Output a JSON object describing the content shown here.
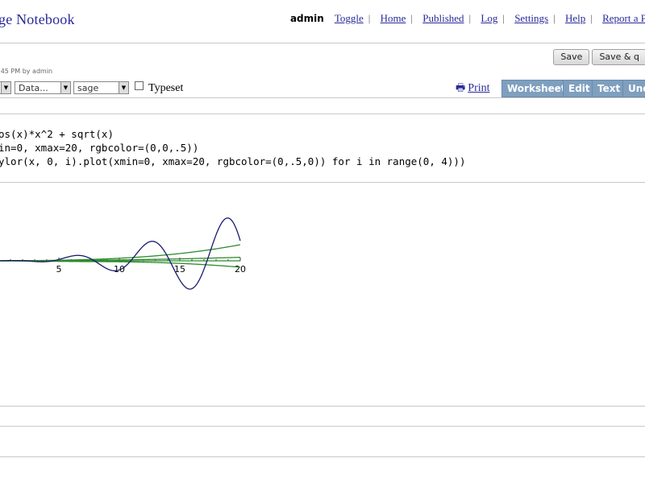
{
  "header": {
    "app_title": "ge Notebook",
    "user": "admin",
    "nav": [
      {
        "label": "Toggle"
      },
      {
        "label": "Home"
      },
      {
        "label": "Published"
      },
      {
        "label": "Log"
      },
      {
        "label": "Settings"
      },
      {
        "label": "Help"
      },
      {
        "label": "Report a P"
      }
    ]
  },
  "save_bar": {
    "save_label": "Save",
    "save_quit_label": "Save & q"
  },
  "last_edited": ":45 PM by admin",
  "toolbar": {
    "select1": "",
    "select2": "Data...",
    "select3": "sage",
    "typeset_label": "Typeset",
    "print_label": "Print",
    "worksheet_label": "Worksheet",
    "edit_label": "Edit",
    "text_label": "Text",
    "undo_label": "Und"
  },
  "cell": {
    "code_lines": [
      "os(x)*x^2 + sqrt(x)",
      "in=0, xmax=20, rgbcolor=(0,0,.5))",
      "ylor(x, 0, i).plot(xmin=0, xmax=20, rgbcolor=(0,.5,0)) for i in range(0, 4)))"
    ]
  },
  "chart_data": {
    "type": "line",
    "xlim": [
      0,
      20
    ],
    "ylim": [
      -260,
      120
    ],
    "x_ticks": [
      "5",
      "10",
      "15",
      "20"
    ],
    "colors": {
      "main": "#1a1a6e",
      "taylor": "#2e8b2e"
    },
    "series": [
      {
        "values_desc": "cos(x)*x^2+sqrt(x) over [0,20]",
        "color": "#1a1a6e"
      },
      {
        "values_desc": "Taylor polynomials of degree 0..3",
        "color": "#2e8b2e"
      }
    ]
  }
}
